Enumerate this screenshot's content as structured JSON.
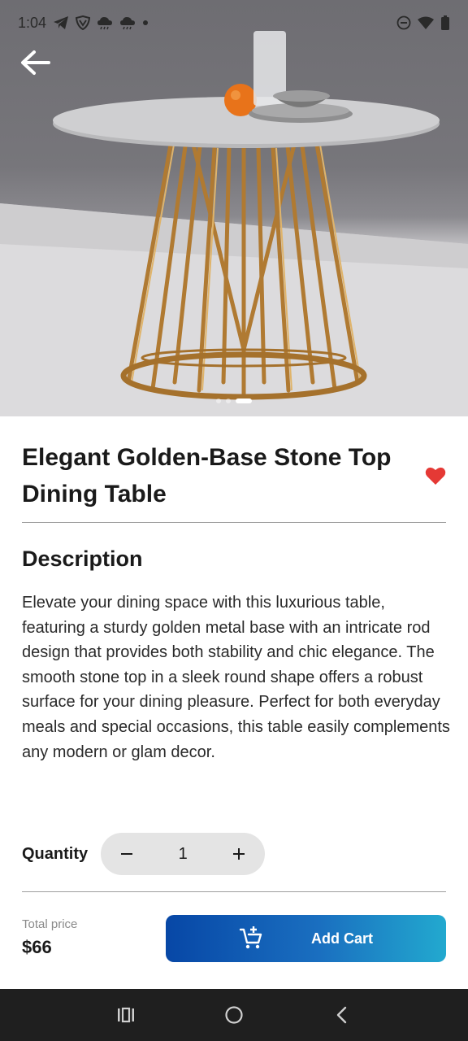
{
  "status_bar": {
    "time": "1:04",
    "left_icons": [
      "telegram-icon",
      "vpn-shield-icon",
      "cloud-icon",
      "cloud-icon",
      "dot-icon"
    ],
    "right_icons": [
      "dnd-icon",
      "wifi-icon",
      "battery-icon"
    ]
  },
  "gallery": {
    "slides": 3,
    "active_slide": 3
  },
  "product": {
    "title": "Elegant Golden-Base Stone Top Dining Table",
    "favorite": true,
    "favorite_color": "#e53935"
  },
  "description": {
    "heading": "Description",
    "text": "Elevate your dining space with this luxurious table, featuring a sturdy golden metal base with an intricate rod design that provides both stability and chic elegance. The smooth stone top in a sleek round shape offers a robust surface for your dining pleasure. Perfect for both everyday meals and special occasions, this table easily complements any modern or glam decor."
  },
  "quantity": {
    "label": "Quantity",
    "value": "1",
    "decrement_symbol": "−",
    "increment_symbol": "+"
  },
  "checkout": {
    "total_label": "Total price",
    "total_value": "$66",
    "button_label": "Add Cart",
    "button_gradient": [
      "#0747a6",
      "#22a9cf"
    ]
  },
  "nav": {
    "icons": [
      "recent-apps-icon",
      "home-icon",
      "back-icon"
    ]
  }
}
